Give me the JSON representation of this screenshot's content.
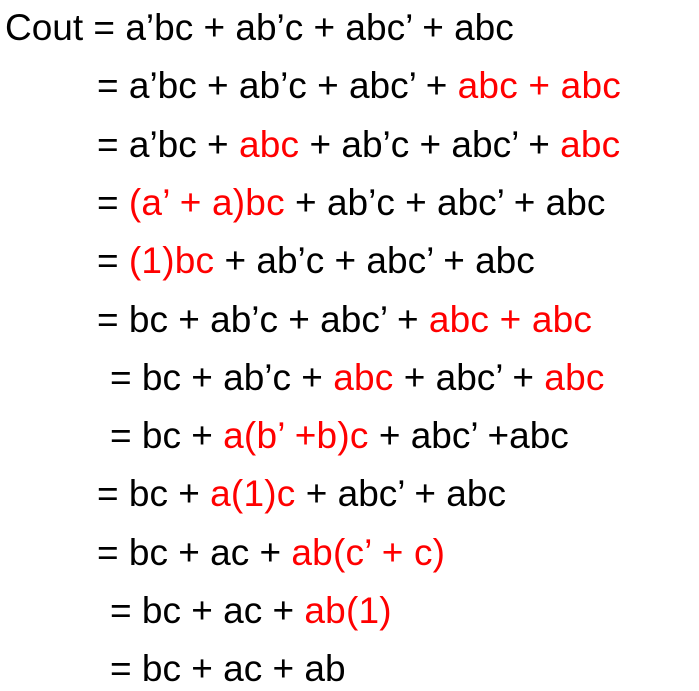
{
  "colors": {
    "normal": "#000000",
    "highlight": "#ff0000"
  },
  "derivation": {
    "lines": [
      {
        "segments": [
          {
            "text": "Cout = a’bc + ab’c + abc’ + abc",
            "highlight": false
          }
        ]
      },
      {
        "segments": [
          {
            "text": "= a’bc + ab’c + abc’ + ",
            "highlight": false
          },
          {
            "text": "abc + abc",
            "highlight": true
          }
        ]
      },
      {
        "segments": [
          {
            "text": "= a’bc + ",
            "highlight": false
          },
          {
            "text": "abc",
            "highlight": true
          },
          {
            "text": " + ab’c + abc’ + ",
            "highlight": false
          },
          {
            "text": "abc",
            "highlight": true
          }
        ]
      },
      {
        "segments": [
          {
            "text": "= ",
            "highlight": false
          },
          {
            "text": "(a’ + a)bc",
            "highlight": true
          },
          {
            "text": " + ab’c + abc’ + abc",
            "highlight": false
          }
        ]
      },
      {
        "segments": [
          {
            "text": "= ",
            "highlight": false
          },
          {
            "text": "(1)bc",
            "highlight": true
          },
          {
            "text": " + ab’c + abc’ + abc",
            "highlight": false
          }
        ]
      },
      {
        "segments": [
          {
            "text": "= bc + ab’c + abc’ + ",
            "highlight": false
          },
          {
            "text": "abc + abc",
            "highlight": true
          }
        ]
      },
      {
        "segments": [
          {
            "text": "= bc + ab’c + ",
            "highlight": false
          },
          {
            "text": "abc",
            "highlight": true
          },
          {
            "text": " + abc’ + ",
            "highlight": false
          },
          {
            "text": "abc",
            "highlight": true
          }
        ]
      },
      {
        "segments": [
          {
            "text": "= bc + ",
            "highlight": false
          },
          {
            "text": "a(b’ +b)c",
            "highlight": true
          },
          {
            "text": " + abc’ +abc",
            "highlight": false
          }
        ]
      },
      {
        "segments": [
          {
            "text": "= bc + ",
            "highlight": false
          },
          {
            "text": "a(1)c",
            "highlight": true
          },
          {
            "text": " + abc’ + abc",
            "highlight": false
          }
        ]
      },
      {
        "segments": [
          {
            "text": "= bc + ac + ",
            "highlight": false
          },
          {
            "text": "ab(c’ + c)",
            "highlight": true
          }
        ]
      },
      {
        "segments": [
          {
            "text": "= bc + ac + ",
            "highlight": false
          },
          {
            "text": "ab(1)",
            "highlight": true
          }
        ]
      },
      {
        "segments": [
          {
            "text": "= bc + ac + ab",
            "highlight": false
          }
        ]
      }
    ]
  }
}
